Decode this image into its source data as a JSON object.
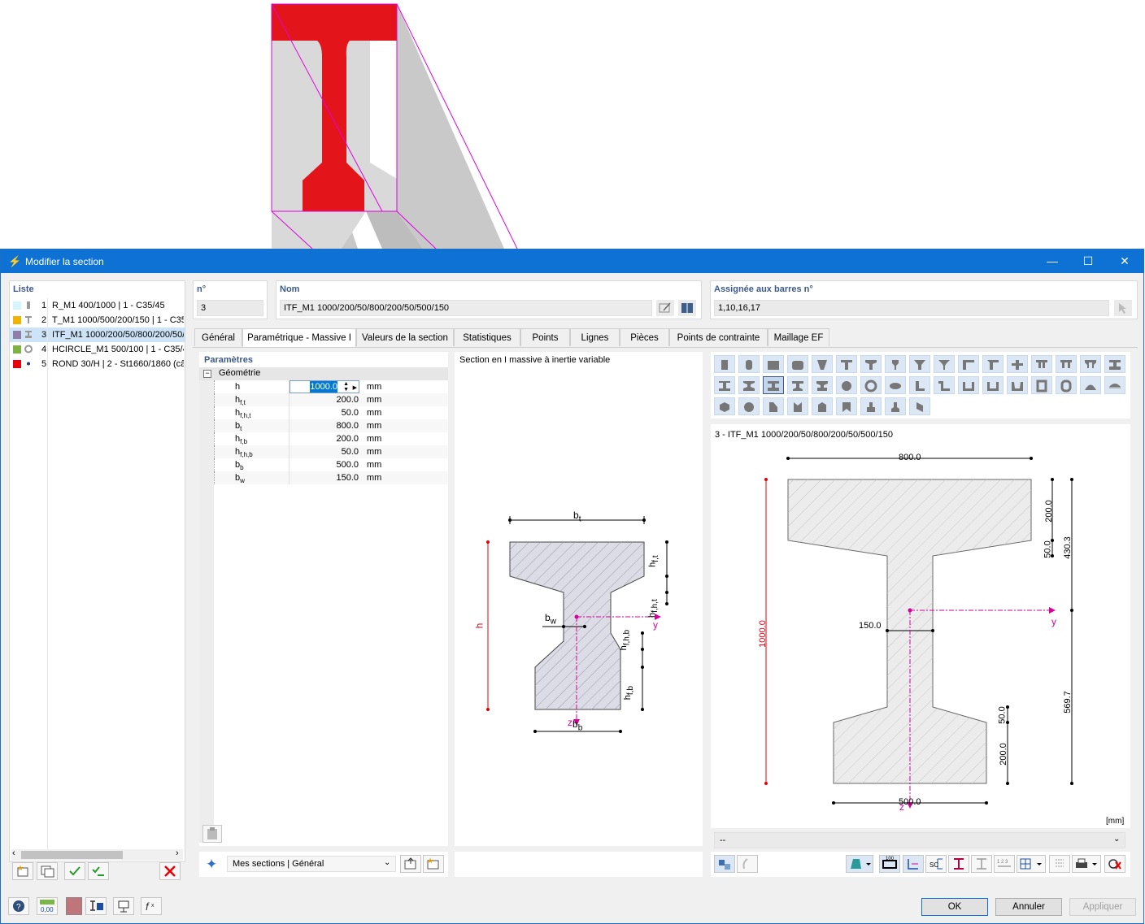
{
  "dialog": {
    "title": "Modifier la section"
  },
  "list": {
    "header": "Liste",
    "items": [
      {
        "num": "1",
        "label": "R_M1 400/1000 | 1 - C35/45",
        "color": "#d6f4fb",
        "icon": "rectangle-icon"
      },
      {
        "num": "2",
        "label": "T_M1 1000/500/200/150 | 1 - C35",
        "color": "#f0b400",
        "icon": "t-section-icon"
      },
      {
        "num": "3",
        "label": "ITF_M1 1000/200/50/800/200/50/",
        "color": "#8e7ea8",
        "icon": "i-section-icon"
      },
      {
        "num": "4",
        "label": "HCIRCLE_M1 500/100 | 1 - C35/4!",
        "color": "#7cb342",
        "icon": "hollow-circle-icon"
      },
      {
        "num": "5",
        "label": "ROND 30/H | 2 - St1660/1860 (câ",
        "color": "#e8000b",
        "icon": "round-bar-icon"
      }
    ],
    "selected_index": 2
  },
  "number": {
    "label": "n°",
    "value": "3"
  },
  "name": {
    "label": "Nom",
    "value": "ITF_M1 1000/200/50/800/200/50/500/150"
  },
  "assigned": {
    "label": "Assignée aux barres n°",
    "value": "1,10,16,17"
  },
  "tabs": [
    "Général",
    "Paramétrique - Massive I",
    "Valeurs de la section",
    "Statistiques",
    "Points",
    "Lignes",
    "Pièces",
    "Points de contrainte",
    "Maillage EF"
  ],
  "active_tab": 1,
  "params": {
    "header": "Paramètres",
    "group": "Géométrie",
    "rows": [
      {
        "sym": "h",
        "sub": "",
        "value": "1000.0",
        "unit": "mm"
      },
      {
        "sym": "h",
        "sub": "f,t",
        "value": "200.0",
        "unit": "mm"
      },
      {
        "sym": "h",
        "sub": "f,h,t",
        "value": "50.0",
        "unit": "mm"
      },
      {
        "sym": "b",
        "sub": "t",
        "value": "800.0",
        "unit": "mm"
      },
      {
        "sym": "h",
        "sub": "f,b",
        "value": "200.0",
        "unit": "mm"
      },
      {
        "sym": "h",
        "sub": "f,h,b",
        "value": "50.0",
        "unit": "mm"
      },
      {
        "sym": "b",
        "sub": "b",
        "value": "500.0",
        "unit": "mm"
      },
      {
        "sym": "b",
        "sub": "w",
        "value": "150.0",
        "unit": "mm"
      }
    ]
  },
  "schema": {
    "title": "Section en I massive à inertie variable",
    "labels": {
      "bt": "b",
      "bt_sub": "t",
      "h": "h",
      "bw": "b",
      "bw_sub": "w",
      "bb": "b",
      "bb_sub": "b",
      "y": "y",
      "z": "z",
      "hft": "h",
      "hft_sub": "f,t",
      "hfht": "h",
      "hfht_sub": "f,h,t",
      "hfhb": "h",
      "hfhb_sub": "f,h,b",
      "hfb": "h",
      "hfb_sub": "f,b"
    }
  },
  "preview": {
    "title": "3 - ITF_M1 1000/200/50/800/200/50/500/150",
    "unit_label": "[mm]",
    "dims": {
      "top_width": "800.0",
      "height": "1000.0",
      "web": "150.0",
      "bottom_width": "500.0",
      "ft": "200.0",
      "fht": "50.0",
      "upper": "430.3",
      "lower": "569.7",
      "fhb": "50.0",
      "fb": "200.0",
      "y": "y",
      "z": "z"
    },
    "dropdown": "--"
  },
  "library": {
    "label": "Mes sections | Général"
  },
  "buttons": {
    "ok": "OK",
    "cancel": "Annuler",
    "apply": "Appliquer"
  },
  "colors": {
    "accent": "#0d72d4",
    "section_red": "#e3151b",
    "dim_red": "#e3000f",
    "axis_magenta": "#d6009b"
  }
}
